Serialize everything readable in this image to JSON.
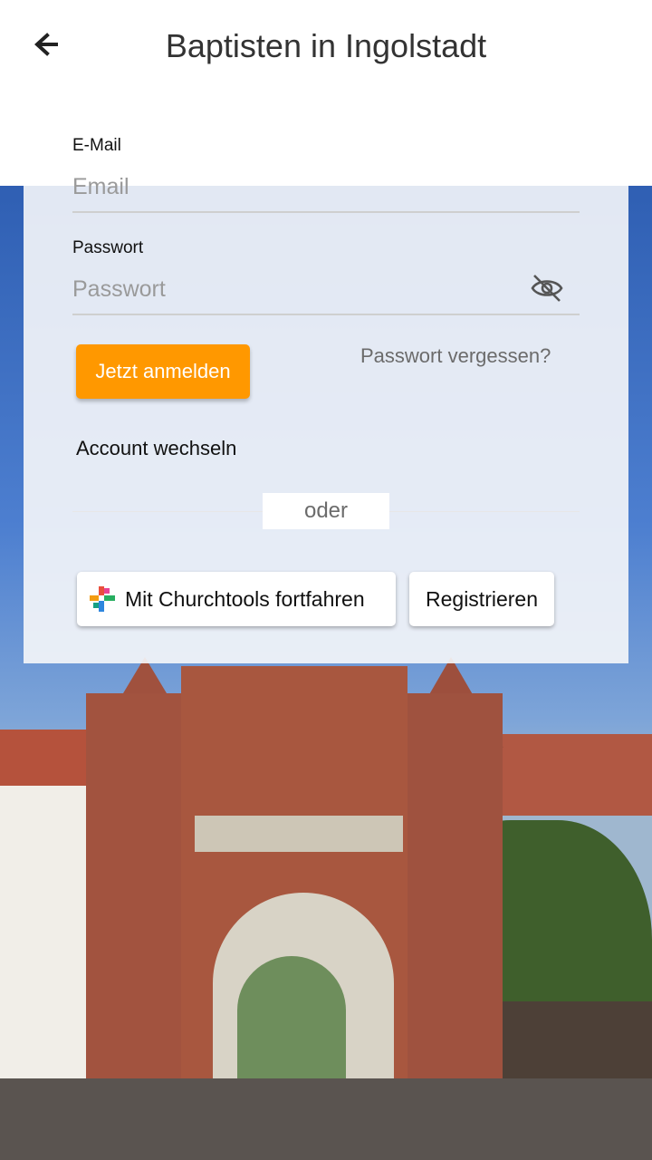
{
  "header": {
    "title": "Baptisten in Ingolstadt",
    "back_icon": "arrow-left-icon"
  },
  "login": {
    "email_label": "E-Mail",
    "email_placeholder": "Email",
    "email_value": "",
    "password_label": "Passwort",
    "password_placeholder": "Passwort",
    "password_value": "",
    "visibility_icon": "eye-off-icon",
    "submit_label": "Jetzt anmelden",
    "forgot_label": "Passwort vergessen?",
    "switch_account_label": "Account wechseln",
    "divider_label": "oder",
    "churchtools_label": "Mit Churchtools fortfahren",
    "churchtools_icon": "churchtools-logo-icon",
    "register_label": "Registrieren"
  },
  "colors": {
    "accent": "#ff9800",
    "text_primary": "#333333",
    "text_muted": "#6b6b6b"
  }
}
